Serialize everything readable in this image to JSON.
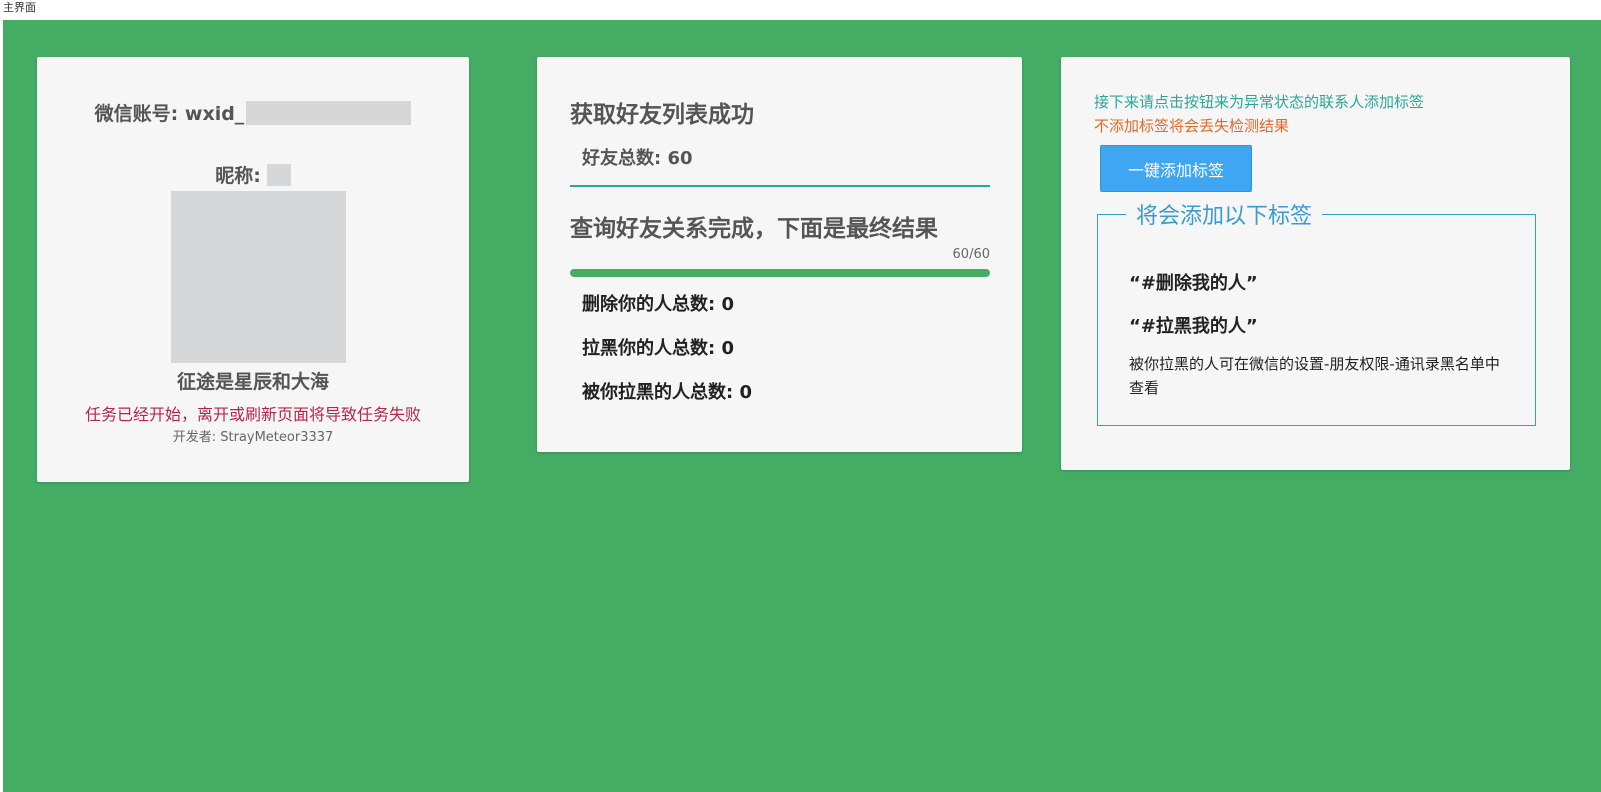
{
  "window": {
    "title": "主界面"
  },
  "colors": {
    "background": "#44ad63",
    "card": "#f6f6f6",
    "warning": "#b5264a",
    "hint_teal": "#2aa79b",
    "hint_orange": "#e06a2a",
    "button": "#3ea6f2",
    "tag_border": "#3a9bd1"
  },
  "account": {
    "wechat_label": "微信账号: wxid_",
    "nickname_label": "昵称:",
    "motto": "征途是星辰和大海",
    "warning": "任务已经开始，离开或刷新页面将导致任务失败",
    "developer": "开发者: StrayMeteor3337"
  },
  "status": {
    "fetch_title": "获取好友列表成功",
    "friends_total": "好友总数: 60",
    "query_title": "查询好友关系完成，下面是最终结果",
    "progress_text": "60/60",
    "progress_fraction": 1.0,
    "results": [
      "删除你的人总数: 0",
      "拉黑你的人总数: 0",
      "被你拉黑的人总数: 0"
    ]
  },
  "tags": {
    "hint_line1": "接下来请点击按钮来为异常状态的联系人添加标签",
    "hint_line2": "不添加标签将会丢失检测结果",
    "add_button": "一键添加标签",
    "legend": "将会添加以下标签",
    "items": [
      "“#删除我的人”",
      "“#拉黑我的人”"
    ],
    "note": "被你拉黑的人可在微信的设置-朋友权限-通讯录黑名单中查看"
  }
}
